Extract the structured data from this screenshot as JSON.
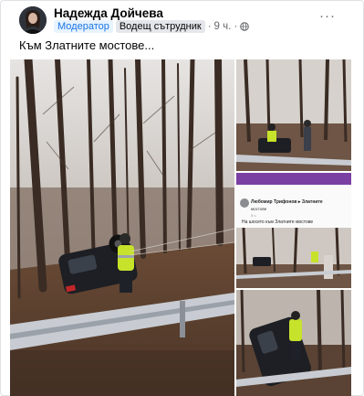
{
  "post": {
    "author": "Надежда Дойчева",
    "role_badge": "Модератор",
    "contributor_badge": "Водещ сътрудник",
    "separator": "·",
    "time": "9 ч.",
    "privacy_icon": "globe-icon",
    "more_label": "···",
    "text": "Към Златните мостове..."
  },
  "screenshot_post": {
    "author": "Любомир Трифонов",
    "arrow": "▸",
    "group": "Златните",
    "group_line2": "мостове",
    "time": "5 ч.",
    "text": "На шосето към Златните мостове"
  },
  "colors": {
    "badge_moderator": "#1b74e4",
    "group_header": "#7a3fa2",
    "barrier": "#c8ccd2",
    "vest": "#c7e22a"
  }
}
